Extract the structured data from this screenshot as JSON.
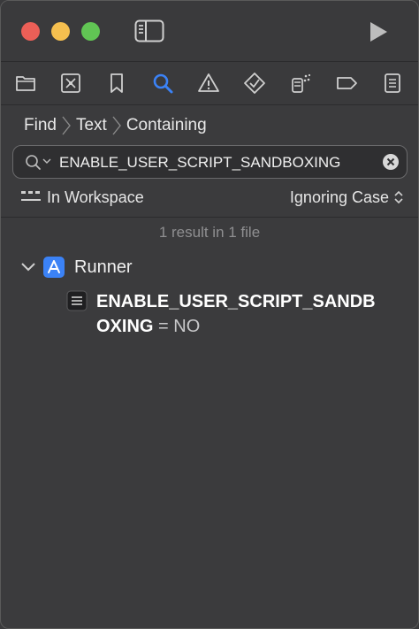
{
  "toolbar": {
    "nav_icons": [
      "folder-icon",
      "source-control-icon",
      "bookmark-icon",
      "search-icon",
      "warning-icon",
      "test-icon",
      "debug-icon",
      "breakpoint-icon",
      "report-icon"
    ]
  },
  "breadcrumb": {
    "items": [
      "Find",
      "Text",
      "Containing"
    ]
  },
  "search": {
    "value": "ENABLE_USER_SCRIPT_SANDBOXING"
  },
  "scope": {
    "location": "In Workspace",
    "case_mode": "Ignoring Case"
  },
  "results": {
    "summary": "1 result in 1 file",
    "group": {
      "name": "Runner"
    },
    "item": {
      "match": "ENABLE_USER_SCRIPT_SANDBOXING",
      "rest": " = NO"
    }
  },
  "colors": {
    "accent": "#3b82f6",
    "background": "#3b3b3d"
  }
}
